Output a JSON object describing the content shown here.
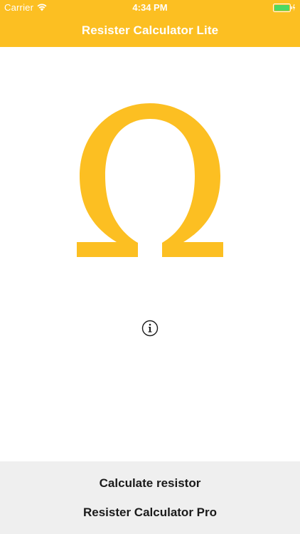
{
  "status_bar": {
    "carrier": "Carrier",
    "time": "4:34 PM"
  },
  "nav": {
    "title": "Resister Calculator Lite"
  },
  "logo": {
    "symbol": "Ω",
    "icon": "omega-icon"
  },
  "info": {
    "icon": "info-icon"
  },
  "actions": {
    "calculate_label": "Calculate resistor",
    "pro_label": "Resister Calculator Pro"
  },
  "colors": {
    "accent": "#fcbf22",
    "panel_bg": "#efefef",
    "battery_green": "#4cd964"
  }
}
